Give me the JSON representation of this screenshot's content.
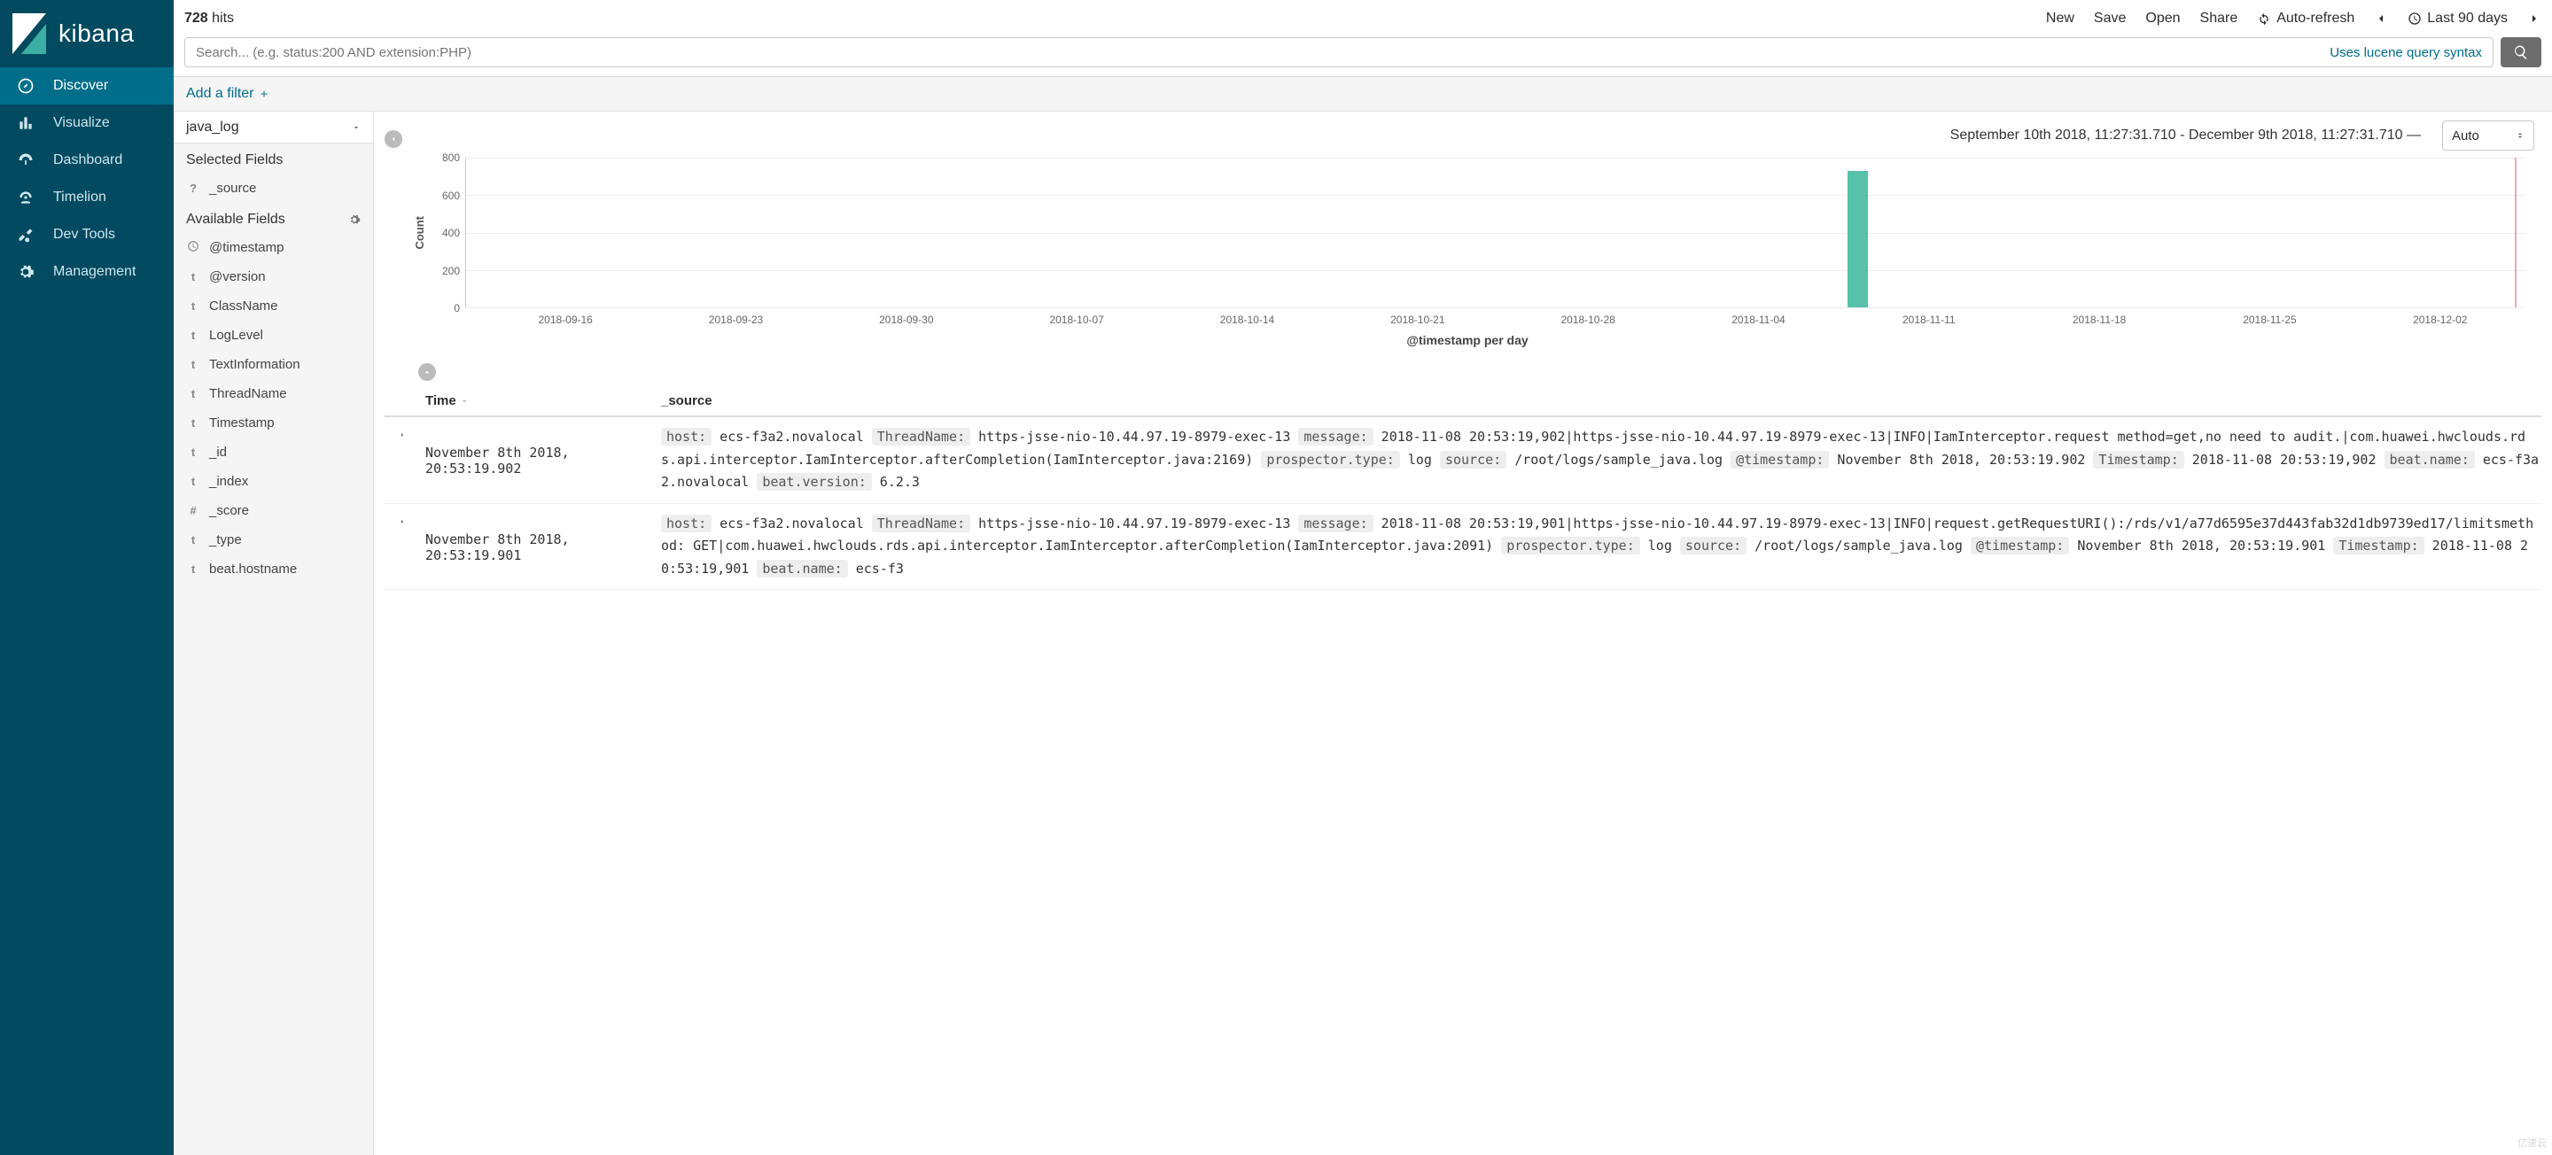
{
  "brand": "kibana",
  "nav": [
    {
      "id": "discover",
      "label": "Discover"
    },
    {
      "id": "visualize",
      "label": "Visualize"
    },
    {
      "id": "dashboard",
      "label": "Dashboard"
    },
    {
      "id": "timelion",
      "label": "Timelion"
    },
    {
      "id": "devtools",
      "label": "Dev Tools"
    },
    {
      "id": "management",
      "label": "Management"
    }
  ],
  "active_nav": "discover",
  "hits": {
    "count": "728",
    "label": "hits"
  },
  "top_actions": {
    "new": "New",
    "save": "Save",
    "open": "Open",
    "share": "Share",
    "autorefresh": "Auto-refresh",
    "timerange": "Last 90 days"
  },
  "search": {
    "placeholder": "Search... (e.g. status:200 AND extension:PHP)",
    "hint": "Uses lucene query syntax",
    "value": ""
  },
  "filter_bar": {
    "add_filter": "Add a filter"
  },
  "index_pattern": "java_log",
  "fields": {
    "selected_title": "Selected Fields",
    "available_title": "Available Fields",
    "selected": [
      {
        "type": "?",
        "name": "_source"
      }
    ],
    "available": [
      {
        "type": "clock",
        "name": "@timestamp"
      },
      {
        "type": "t",
        "name": "@version"
      },
      {
        "type": "t",
        "name": "ClassName"
      },
      {
        "type": "t",
        "name": "LogLevel"
      },
      {
        "type": "t",
        "name": "TextInformation"
      },
      {
        "type": "t",
        "name": "ThreadName"
      },
      {
        "type": "t",
        "name": "Timestamp"
      },
      {
        "type": "t",
        "name": "_id"
      },
      {
        "type": "t",
        "name": "_index"
      },
      {
        "type": "#",
        "name": "_score"
      },
      {
        "type": "t",
        "name": "_type"
      },
      {
        "type": "t",
        "name": "beat.hostname"
      }
    ]
  },
  "time_header": {
    "range": "September 10th 2018, 11:27:31.710 - December 9th 2018, 11:27:31.710 —",
    "interval": "Auto"
  },
  "chart_data": {
    "type": "bar",
    "ylabel": "Count",
    "xlabel": "@timestamp per day",
    "ylim": [
      0,
      800
    ],
    "y_ticks": [
      0,
      200,
      400,
      600,
      800
    ],
    "categories": [
      "2018-09-16",
      "2018-09-23",
      "2018-09-30",
      "2018-10-07",
      "2018-10-14",
      "2018-10-21",
      "2018-10-28",
      "2018-11-04",
      "2018-11-11",
      "2018-11-18",
      "2018-11-25",
      "2018-12-02"
    ],
    "series": [
      {
        "name": "hits",
        "values": [
          0,
          0,
          0,
          0,
          0,
          0,
          0,
          0,
          728,
          0,
          0,
          0
        ]
      }
    ],
    "cursor_x_frac": 0.995
  },
  "table": {
    "columns": {
      "time": "Time",
      "source": "_source"
    },
    "rows": [
      {
        "time": "November 8th 2018, 20:53:19.902",
        "kv": [
          {
            "k": "host:",
            "v": "ecs-f3a2.novalocal"
          },
          {
            "k": "ThreadName:",
            "v": "https-jsse-nio-10.44.97.19-8979-exec-13"
          },
          {
            "k": "message:",
            "v": "2018-11-08 20:53:19,902|https-jsse-nio-10.44.97.19-8979-exec-13|INFO|IamInterceptor.request method=get,no need to audit.|com.huawei.hwclouds.rds.api.interceptor.IamInterceptor.afterCompletion(IamInterceptor.java:2169)"
          },
          {
            "k": "prospector.type:",
            "v": "log"
          },
          {
            "k": "source:",
            "v": "/root/logs/sample_java.log"
          },
          {
            "k": "@timestamp:",
            "v": "November 8th 2018, 20:53:19.902"
          },
          {
            "k": "Timestamp:",
            "v": "2018-11-08 20:53:19,902"
          },
          {
            "k": "beat.name:",
            "v": "ecs-f3a2.novalocal"
          },
          {
            "k": "beat.version:",
            "v": "6.2.3"
          }
        ]
      },
      {
        "time": "November 8th 2018, 20:53:19.901",
        "kv": [
          {
            "k": "host:",
            "v": "ecs-f3a2.novalocal"
          },
          {
            "k": "ThreadName:",
            "v": "https-jsse-nio-10.44.97.19-8979-exec-13"
          },
          {
            "k": "message:",
            "v": "2018-11-08 20:53:19,901|https-jsse-nio-10.44.97.19-8979-exec-13|INFO|request.getRequestURI():/rds/v1/a77d6595e37d443fab32d1db9739ed17/limitsmethod: GET|com.huawei.hwclouds.rds.api.interceptor.IamInterceptor.afterCompletion(IamInterceptor.java:2091)"
          },
          {
            "k": "prospector.type:",
            "v": "log"
          },
          {
            "k": "source:",
            "v": "/root/logs/sample_java.log"
          },
          {
            "k": "@timestamp:",
            "v": "November 8th 2018, 20:53:19.901"
          },
          {
            "k": "Timestamp:",
            "v": "2018-11-08 20:53:19,901"
          },
          {
            "k": "beat.name:",
            "v": "ecs-f3"
          }
        ]
      }
    ]
  },
  "watermark": "亿速云"
}
